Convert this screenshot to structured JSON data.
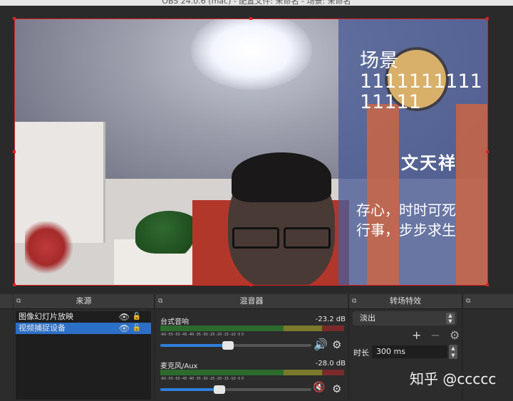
{
  "window": {
    "title": "OBS 24.0.6 (mac) - 配置文件: 未命名 - 场景: 未命名"
  },
  "preview": {
    "text_source": "场景\n1111111111\n11111",
    "poster_name": "文天祥",
    "poster_quote_line1": "存心，时时可死",
    "poster_quote_line2": "行事，步步求生"
  },
  "docks": {
    "sources_title": "来源",
    "mixer_title": "混音器",
    "transitions_title": "转场特效"
  },
  "sources": [
    {
      "label": "图像幻灯片放映",
      "selected": false
    },
    {
      "label": "视频捕捉设备",
      "selected": true
    }
  ],
  "mixer": [
    {
      "name": "台式音响",
      "db": "-23.2 dB",
      "volume": 0.45,
      "muted": false
    },
    {
      "name": "麦克风/Aux",
      "db": "-28.0 dB",
      "volume": 0.39,
      "muted": true
    }
  ],
  "meter_scale": "-60 -55 -50 -45 -40 -35 -30 -25 -20 -15 -10 -5 0",
  "transitions": {
    "selected": "淡出",
    "duration_label": "时长",
    "duration_value": "300 ms"
  },
  "watermark": "知乎 @ccccc",
  "colors": {
    "selection": "#2b6fc6",
    "bounding_box": "#e02020",
    "volume_fill": "#2f7fd8",
    "mute_red": "#e02020"
  }
}
